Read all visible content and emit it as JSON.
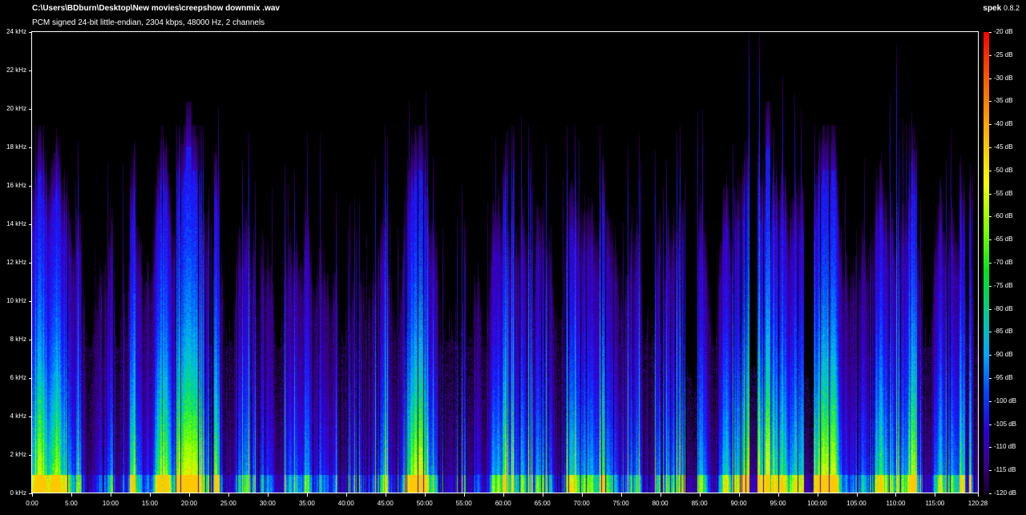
{
  "window": {
    "file_path": "C:\\Users\\BDburn\\Desktop\\New movies\\creepshow downmix .wav",
    "audio_info": "PCM signed 24-bit little-endian, 2304 kbps, 48000 Hz, 2 channels",
    "app_name": "spek",
    "app_version": "0.8.2"
  },
  "axes": {
    "frequency_labels": [
      "0 kHz",
      "2 kHz",
      "4 kHz",
      "6 kHz",
      "8 kHz",
      "10 kHz",
      "12 kHz",
      "14 kHz",
      "16 kHz",
      "18 kHz",
      "20 kHz",
      "22 kHz",
      "24 kHz"
    ],
    "time_labels": [
      "0:00",
      "5:00",
      "10:00",
      "15:00",
      "20:00",
      "25:00",
      "30:00",
      "35:00",
      "40:00",
      "45:00",
      "50:00",
      "55:00",
      "60:00",
      "65:00",
      "70:00",
      "75:00",
      "80:00",
      "85:00",
      "90:00",
      "95:00",
      "100:00",
      "105:00",
      "110:00",
      "115:00",
      "120:28"
    ],
    "time_values_min": [
      0,
      5,
      10,
      15,
      20,
      25,
      30,
      35,
      40,
      45,
      50,
      55,
      60,
      65,
      70,
      75,
      80,
      85,
      90,
      95,
      100,
      105,
      110,
      115,
      120.4667
    ],
    "total_duration_min": 120.4667,
    "max_frequency_khz": 24
  },
  "colorbar": {
    "db_labels": [
      "-20 dB",
      "-25 dB",
      "-30 dB",
      "-35 dB",
      "-40 dB",
      "-45 dB",
      "-50 dB",
      "-55 dB",
      "-60 dB",
      "-65 dB",
      "-70 dB",
      "-75 dB",
      "-80 dB",
      "-85 dB",
      "-90 dB",
      "-95 dB",
      "-100 dB",
      "-105 dB",
      "-110 dB",
      "-115 dB",
      "-120 dB"
    ]
  }
}
